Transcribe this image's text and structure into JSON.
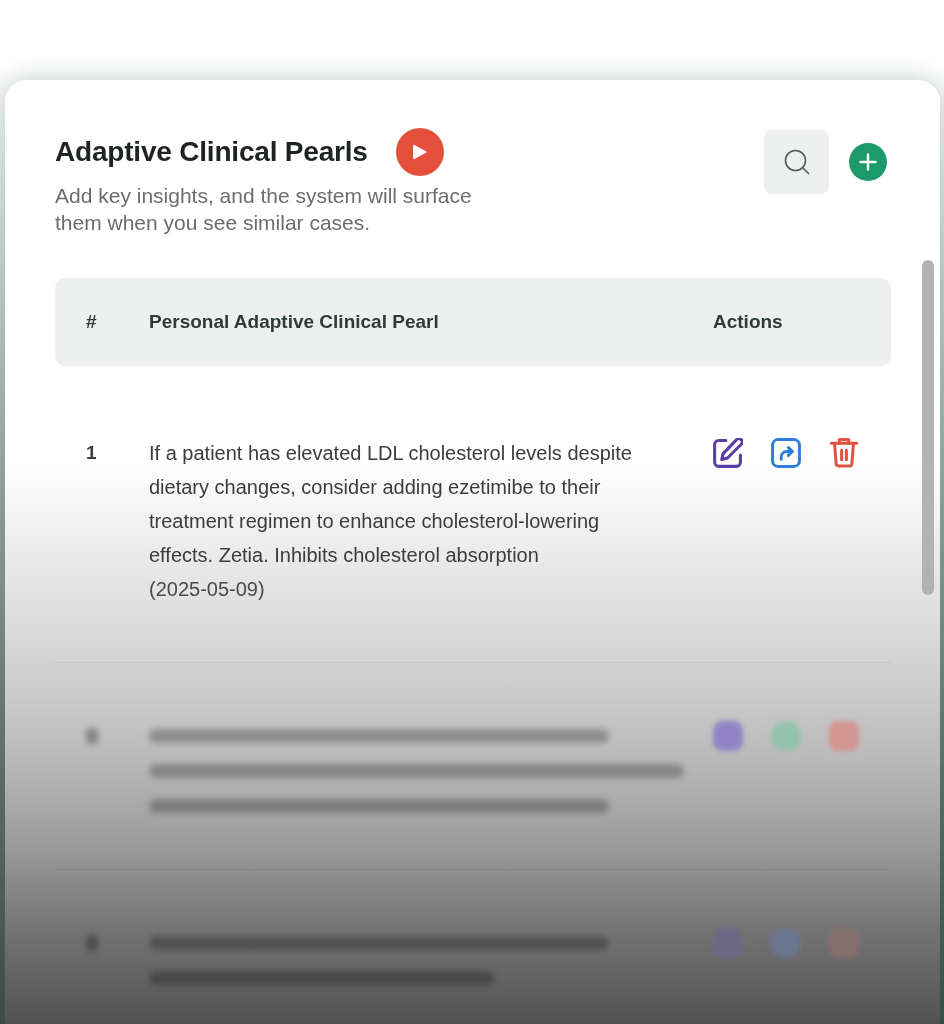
{
  "header": {
    "title": "Adaptive Clinical Pearls",
    "subtitle": "Add key insights, and the system will surface them when you see similar cases."
  },
  "table": {
    "columns": [
      "#",
      "Personal Adaptive Clinical Pearl",
      "Actions"
    ],
    "rows": [
      {
        "kind": "text",
        "number": "1",
        "pearl": "If a patient has elevated LDL cholesterol levels despite dietary changes, consider adding ezetimibe to their treatment regimen to enhance cholesterol-lowering effects. Zetia. Inhibits cholesterol absorption",
        "date": "(2025-05-09)"
      },
      {
        "kind": "blurred",
        "lines": [
          {
            "kind": "wide"
          },
          {
            "kind": "full"
          },
          {
            "kind": "wide"
          }
        ],
        "actions": [
          {
            "color": "#9184c6"
          },
          {
            "color": "#93c2aa"
          },
          {
            "color": "#d39590"
          }
        ]
      },
      {
        "kind": "blurred",
        "lines": [
          {
            "kind": "wide"
          },
          {
            "kind": "medium"
          }
        ],
        "actions": [
          {
            "color": "#6e6887"
          },
          {
            "color": "#6b7691"
          },
          {
            "color": "#85706c"
          }
        ]
      }
    ]
  }
}
